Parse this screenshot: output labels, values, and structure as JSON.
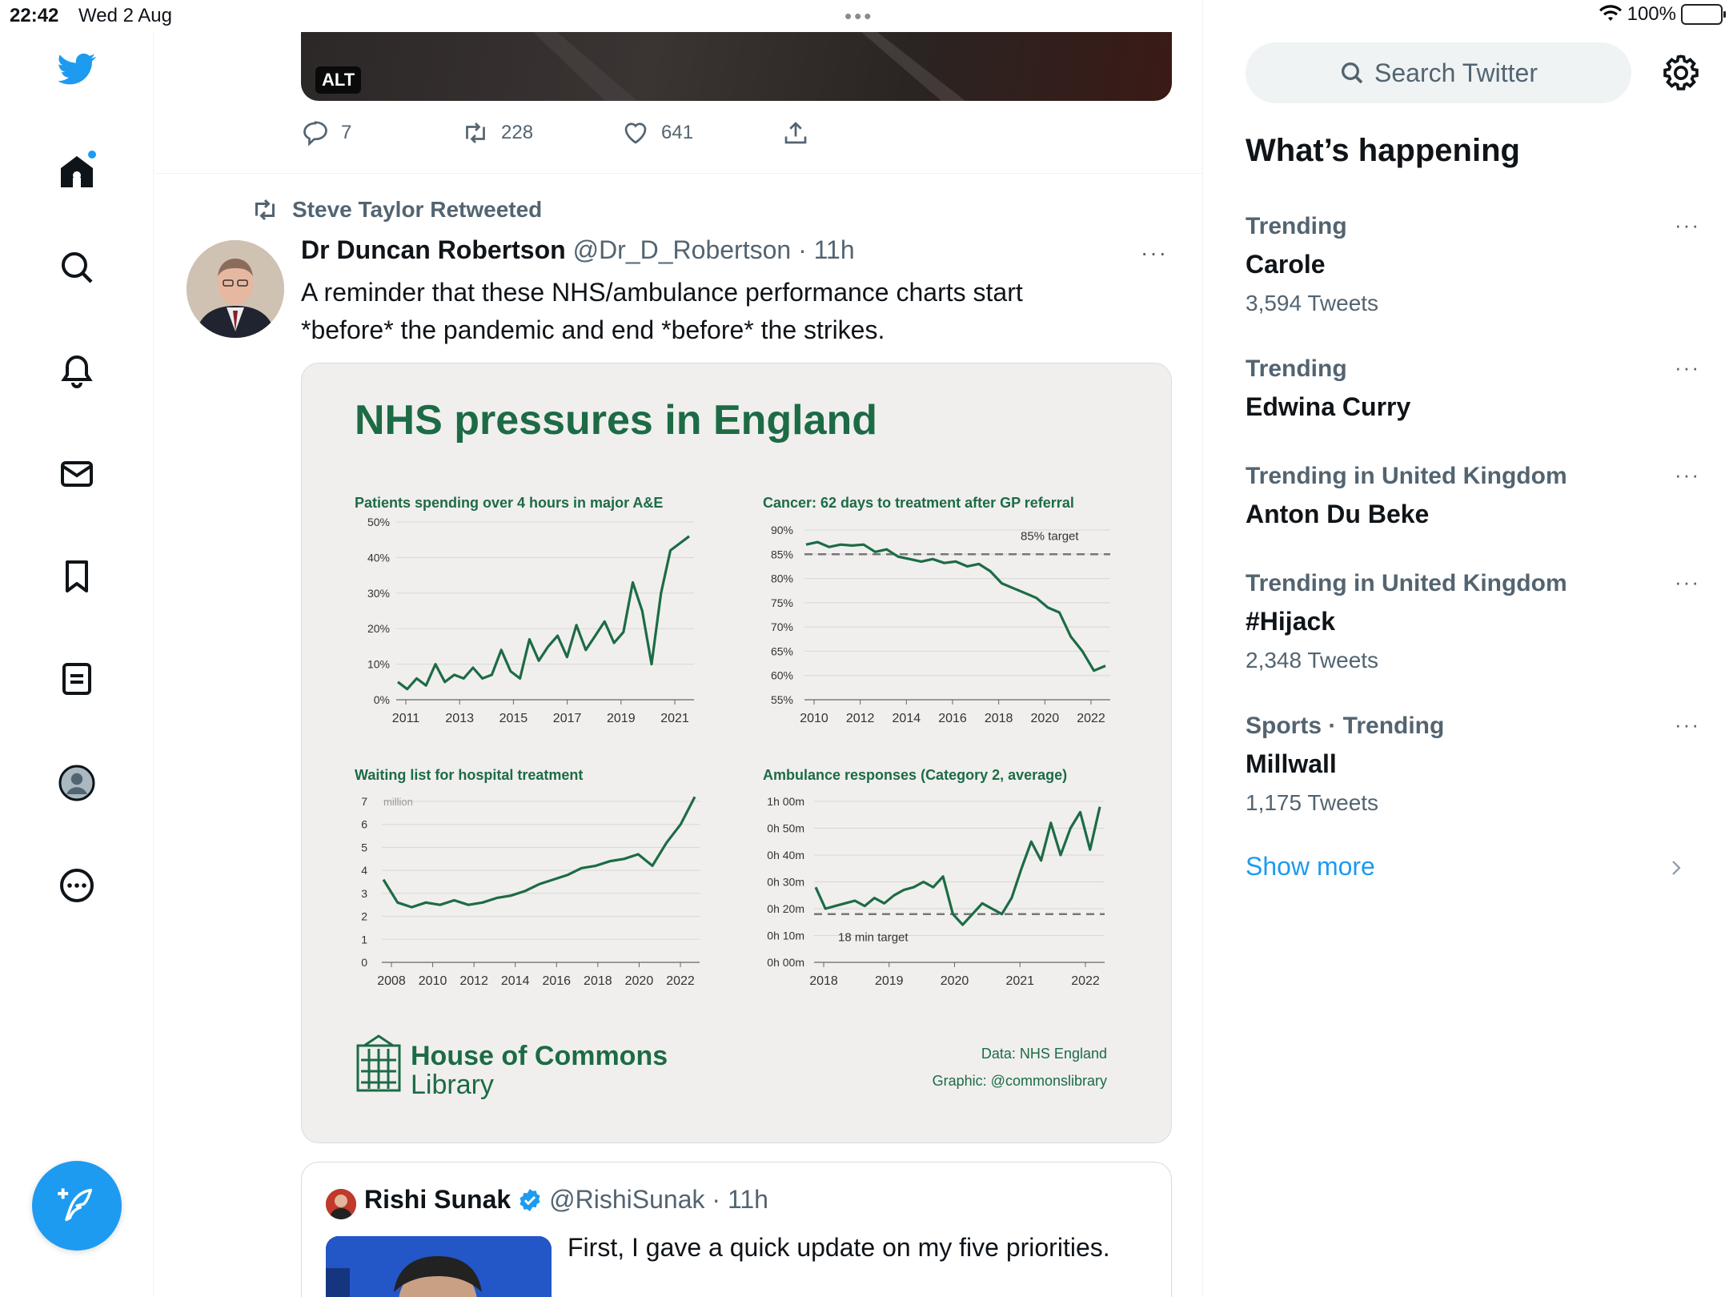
{
  "status_bar": {
    "time": "22:42",
    "date": "Wed 2 Aug",
    "battery": "100%"
  },
  "nav": {
    "items": [
      "home",
      "explore",
      "notifications",
      "messages",
      "bookmarks",
      "lists",
      "profile",
      "more"
    ]
  },
  "prev_tweet": {
    "alt_label": "ALT",
    "replies": "7",
    "retweets": "228",
    "likes": "641"
  },
  "tweet": {
    "retweeted_by": "Steve Taylor Retweeted",
    "author_name": "Dr Duncan Robertson",
    "author_meta": "@Dr_D_Robertson · 11h",
    "more": "···",
    "text": "A reminder that these NHS/ambulance performance charts start *before* the pandemic and end *before* the strikes."
  },
  "quoted": {
    "author_name": "Rishi Sunak",
    "author_meta": "@RishiSunak · 11h",
    "text": "First, I gave a quick update on my five priorities."
  },
  "chart_card": {
    "title": "NHS pressures in England",
    "logo_line1": "House of Commons",
    "logo_line2": "Library",
    "source": "Data: NHS England",
    "graphic_credit": "Graphic: @commonslibrary"
  },
  "chart_data": [
    {
      "type": "line",
      "title": "Patients spending over 4 hours in major A&E",
      "ylim": [
        0,
        50
      ],
      "yticks": [
        "50%",
        "40%",
        "30%",
        "20%",
        "10%",
        "0%"
      ],
      "xticks": [
        "2011",
        "2013",
        "2015",
        "2017",
        "2019",
        "2021"
      ],
      "series": [
        {
          "values": [
            5,
            3,
            6,
            4,
            10,
            5,
            7,
            6,
            9,
            6,
            7,
            14,
            8,
            6,
            17,
            11,
            15,
            18,
            12,
            21,
            14,
            18,
            22,
            16,
            19,
            33,
            25,
            10,
            30,
            42,
            44,
            46
          ]
        }
      ]
    },
    {
      "type": "line",
      "title": "Cancer: 62 days to treatment after GP referral",
      "ylim": [
        55,
        90
      ],
      "yticks": [
        "90%",
        "85%",
        "80%",
        "75%",
        "70%",
        "65%",
        "60%",
        "55%"
      ],
      "xticks": [
        "2010",
        "2012",
        "2014",
        "2016",
        "2018",
        "2020",
        "2022"
      ],
      "annotation": "85% target",
      "target": 85,
      "series": [
        {
          "values": [
            87,
            87.5,
            86.5,
            87,
            86.8,
            87,
            85.5,
            86,
            84.5,
            84,
            83.5,
            84,
            83.2,
            83.5,
            82.5,
            83,
            81.5,
            79,
            78,
            77,
            76,
            74,
            73,
            68,
            65,
            61,
            62
          ]
        }
      ]
    },
    {
      "type": "line",
      "title": "Waiting list for hospital treatment",
      "ylim": [
        0,
        7
      ],
      "ylabel": "million",
      "yticks": [
        "7",
        "6",
        "5",
        "4",
        "3",
        "2",
        "1",
        "0"
      ],
      "xticks": [
        "2008",
        "2010",
        "2012",
        "2014",
        "2016",
        "2018",
        "2020",
        "2022"
      ],
      "series": [
        {
          "values": [
            3.6,
            2.6,
            2.4,
            2.6,
            2.5,
            2.7,
            2.5,
            2.6,
            2.8,
            2.9,
            3.1,
            3.4,
            3.6,
            3.8,
            4.1,
            4.2,
            4.4,
            4.5,
            4.7,
            4.2,
            5.2,
            6.0,
            7.2
          ]
        }
      ]
    },
    {
      "type": "line",
      "title": "Ambulance responses (Category 2, average)",
      "ylim": [
        0,
        60
      ],
      "yticks": [
        "1h 00m",
        "0h 50m",
        "0h 40m",
        "0h 30m",
        "0h 20m",
        "0h 10m",
        "0h 00m"
      ],
      "xticks": [
        "2018",
        "2019",
        "2020",
        "2021",
        "2022"
      ],
      "annotation": "18 min target",
      "target": 18,
      "series": [
        {
          "values": [
            28,
            20,
            21,
            22,
            23,
            21,
            24,
            22,
            25,
            27,
            28,
            30,
            28,
            32,
            18,
            14,
            18,
            22,
            20,
            18,
            24,
            35,
            45,
            38,
            52,
            40,
            50,
            56,
            42,
            58
          ]
        }
      ]
    }
  ],
  "sidebar": {
    "search_placeholder": "Search Twitter",
    "heading": "What’s happening",
    "trends": [
      {
        "category": "Trending",
        "name": "Carole",
        "count": "3,594 Tweets"
      },
      {
        "category": "Trending",
        "name": "Edwina Curry",
        "count": ""
      },
      {
        "category": "Trending in United Kingdom",
        "name": "Anton Du Beke",
        "count": ""
      },
      {
        "category": "Trending in United Kingdom",
        "name": "#Hijack",
        "count": "2,348 Tweets"
      },
      {
        "category": "Sports · Trending",
        "name": "Millwall",
        "count": "1,175 Tweets"
      }
    ],
    "show_more": "Show more",
    "more": "···"
  }
}
